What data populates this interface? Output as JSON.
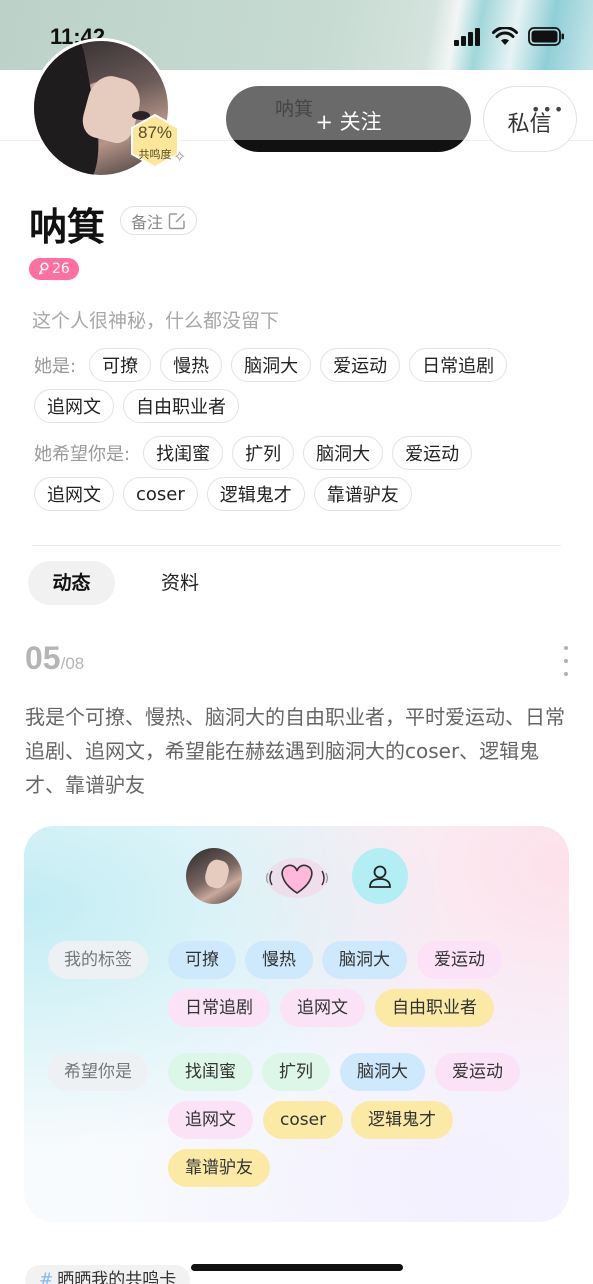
{
  "status_bar": {
    "time": "11:42"
  },
  "header": {
    "follow_ghost_name": "呐箕",
    "follow_label": "+ 关注",
    "message_label": "私信"
  },
  "profile": {
    "match_percent": "87%",
    "match_label": "共鸣度",
    "name": "呐箕",
    "remark_label": "备注",
    "age": "26",
    "bio": "这个人很神秘，什么都没留下",
    "she_is_label": "她是:",
    "she_is_tags": [
      "可撩",
      "慢热",
      "脑洞大",
      "爱运动",
      "日常追剧",
      "追网文",
      "自由职业者"
    ],
    "hopes_label": "她希望你是:",
    "hopes_tags": [
      "找闺蜜",
      "扩列",
      "脑洞大",
      "爱运动",
      "追网文",
      "coser",
      "逻辑鬼才",
      "靠谱驴友"
    ]
  },
  "tabs": {
    "active": "动态",
    "other": "资料"
  },
  "post": {
    "day": "05",
    "month": "/08",
    "text": "我是个可撩、慢热、脑洞大的自由职业者，平时爱运动、日常追剧、追网文，希望能在赫兹遇到脑洞大的coser、逻辑鬼才、靠谱驴友",
    "card": {
      "my_tags_label": "我的标签",
      "my_tags": [
        "可撩",
        "慢热",
        "脑洞大",
        "爱运动",
        "日常追剧",
        "追网文",
        "自由职业者"
      ],
      "hope_label": "希望你是",
      "hope_tags": [
        "找闺蜜",
        "扩列",
        "脑洞大",
        "爱运动",
        "追网文",
        "coser",
        "逻辑鬼才",
        "靠谱驴友"
      ]
    }
  },
  "bottom_topic": {
    "hash": "#",
    "text": "晒晒我的共鸣卡"
  },
  "colors": {
    "age_badge": "#ff6f9f",
    "follow_button": "#6a6a6a",
    "chip_blue": "#cde9fb",
    "chip_pink": "#fbe2f6",
    "chip_yellow": "#faeaa6",
    "chip_green": "#dcf7e8"
  }
}
